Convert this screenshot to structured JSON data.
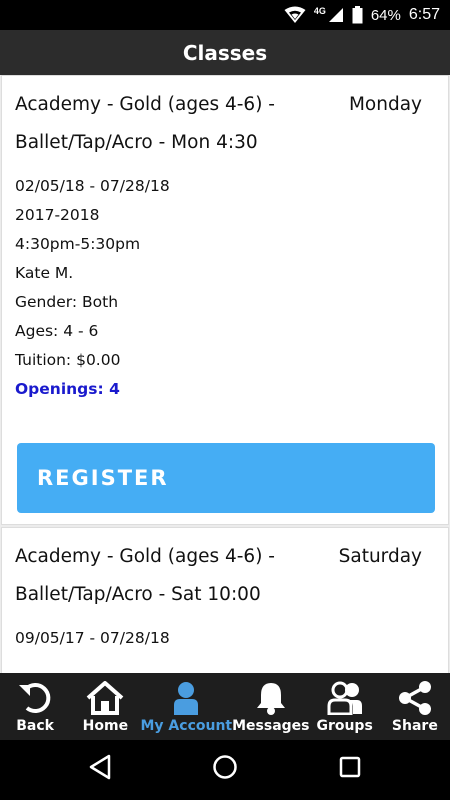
{
  "status": {
    "battery": "64%",
    "time": "6:57",
    "network": "4G"
  },
  "header": {
    "title": "Classes"
  },
  "classes": [
    {
      "name": "Academy - Gold (ages 4-6) - Ballet/Tap/Acro - Mon 4:30",
      "day": "Monday",
      "dates": "02/05/18 - 07/28/18",
      "season": "2017-2018",
      "time": "4:30pm-5:30pm",
      "instructor": "Kate M.",
      "gender": "Gender: Both",
      "ages": "Ages: 4 - 6",
      "tuition": "Tuition: $0.00",
      "openings": "Openings: 4",
      "register_label": "REGISTER"
    },
    {
      "name": "Academy - Gold (ages 4-6) - Ballet/Tap/Acro - Sat 10:00",
      "day": "Saturday",
      "dates": "09/05/17 - 07/28/18"
    }
  ],
  "tabs": [
    {
      "label": "Back",
      "icon": "back-arrow-icon"
    },
    {
      "label": "Home",
      "icon": "home-icon"
    },
    {
      "label": "My Account",
      "icon": "person-icon",
      "active": true
    },
    {
      "label": "Messages",
      "icon": "bell-icon"
    },
    {
      "label": "Groups",
      "icon": "group-icon"
    },
    {
      "label": "Share",
      "icon": "share-icon"
    }
  ],
  "colors": {
    "accent": "#45adf4",
    "active_tab": "#4a9de0",
    "openings": "#1a1acd",
    "appbar": "#2c2c2c"
  }
}
